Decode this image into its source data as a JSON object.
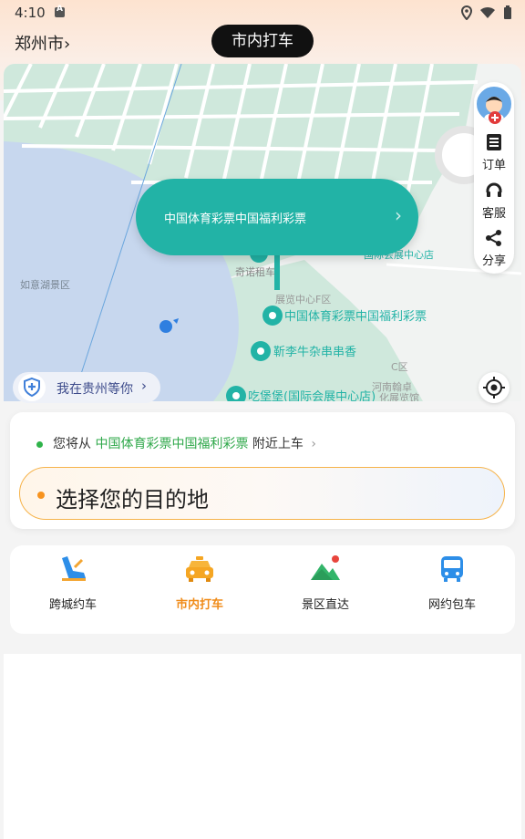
{
  "status_bar": {
    "time": "4:10"
  },
  "header": {
    "city": "郑州市",
    "city_chevron": "›",
    "title": "市内打车"
  },
  "map": {
    "bubble_label": "中国体育彩票中国福利彩票",
    "labels": {
      "ruyi_lake": "如意湖景区",
      "qinuo": "奇诺租车",
      "exhibit_f": "展览中心F区",
      "poi_lottery": "中国体育彩票中国福利彩票",
      "poi_jinli": "靳李牛杂串串香",
      "poi_hotel": "国际会展中心店",
      "area_c": "C区",
      "hanzhuo": "河南翰卓",
      "cultural": "化展览馆",
      "poi_kfc": "吃堡堡(国际会展中心店)"
    },
    "side_panel": [
      {
        "icon": "order-icon",
        "label": "订单"
      },
      {
        "icon": "headset-icon",
        "label": "客服"
      },
      {
        "icon": "share-icon",
        "label": "分享"
      }
    ],
    "location_chip": "我在贵州等你"
  },
  "pickup": {
    "prefix": "您将从",
    "poi": "中国体育彩票中国福利彩票",
    "suffix": "附近上车"
  },
  "destination": {
    "placeholder": "选择您的目的地"
  },
  "services": [
    {
      "label": "跨城约车",
      "icon": "seat-icon",
      "active": false
    },
    {
      "label": "市内打车",
      "icon": "taxi-icon",
      "active": true
    },
    {
      "label": "景区直达",
      "icon": "mountain-icon",
      "active": false
    },
    {
      "label": "网约包车",
      "icon": "bus-icon",
      "active": false
    }
  ],
  "colors": {
    "accent_teal": "#22b3a6",
    "active_orange": "#f08c1a",
    "poi_green": "#2fa84a"
  }
}
